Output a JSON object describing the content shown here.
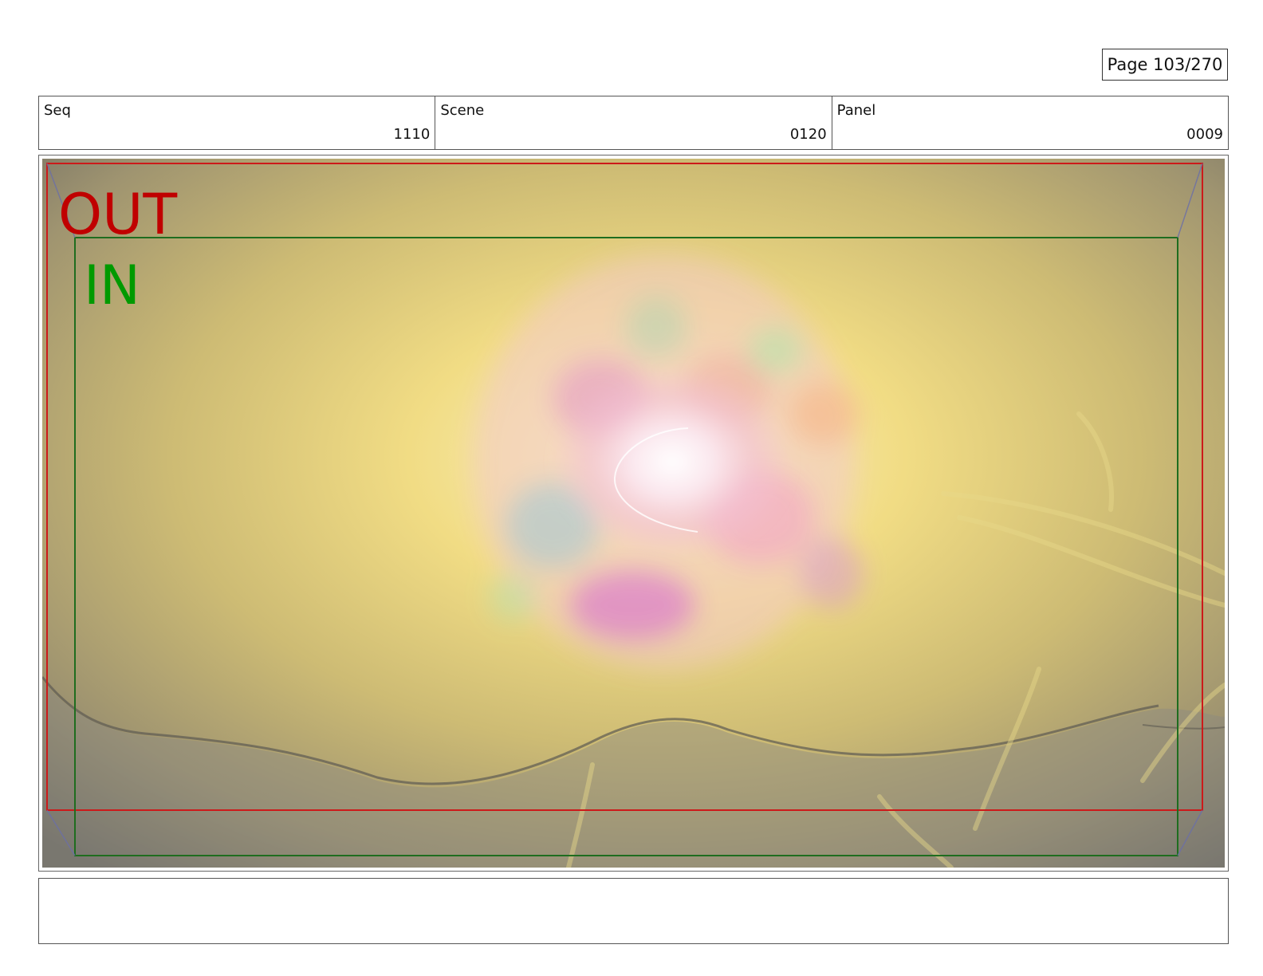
{
  "page": {
    "label": "Page 103/270"
  },
  "header": {
    "seq": {
      "label": "Seq",
      "value": "1110"
    },
    "scene": {
      "label": "Scene",
      "value": "0120"
    },
    "panel": {
      "label": "Panel",
      "value": "0009"
    }
  },
  "frame": {
    "out_label": "OUT",
    "in_label": "IN",
    "out_color": "#c00000",
    "in_color": "#009a00"
  },
  "notes": {
    "text": ""
  }
}
